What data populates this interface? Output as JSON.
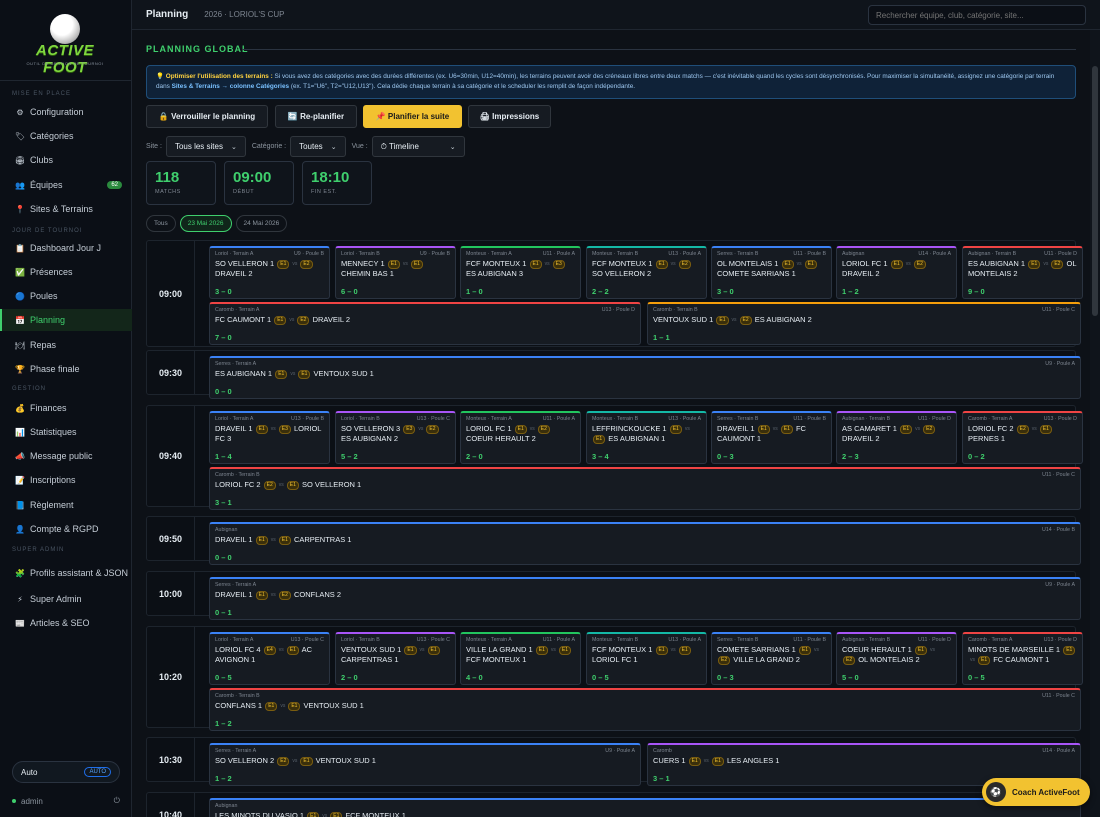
{
  "brand": {
    "name": "ACTIVE FOOT",
    "tagline": "OUTIL DE GESTION DE TOURNOI"
  },
  "sidebar": {
    "sections": [
      "MISE EN PLACE",
      "JOUR DE TOURNOI",
      "GESTION",
      "SUPER ADMIN"
    ],
    "items": [
      {
        "icon": "gear-icon",
        "glyph": "⚙",
        "label": "Configuration"
      },
      {
        "icon": "tag-icon",
        "glyph": "🏷",
        "label": "Catégories"
      },
      {
        "icon": "club-icon",
        "glyph": "🏟",
        "label": "Clubs"
      },
      {
        "icon": "team-icon",
        "glyph": "👥",
        "label": "Équipes",
        "badge": "62"
      },
      {
        "icon": "pin-icon",
        "glyph": "📍",
        "label": "Sites & Terrains"
      },
      {
        "icon": "dashboard-icon",
        "glyph": "📋",
        "label": "Dashboard Jour J"
      },
      {
        "icon": "check-icon",
        "glyph": "✅",
        "label": "Présences"
      },
      {
        "icon": "pool-icon",
        "glyph": "🔵",
        "label": "Poules"
      },
      {
        "icon": "calendar-icon",
        "glyph": "📅",
        "label": "Planning"
      },
      {
        "icon": "meal-icon",
        "glyph": "🍽",
        "label": "Repas"
      },
      {
        "icon": "trophy-icon",
        "glyph": "🏆",
        "label": "Phase finale"
      },
      {
        "icon": "money-icon",
        "glyph": "💰",
        "label": "Finances"
      },
      {
        "icon": "chart-icon",
        "glyph": "📊",
        "label": "Statistiques"
      },
      {
        "icon": "megaphone-icon",
        "glyph": "📣",
        "label": "Message public"
      },
      {
        "icon": "form-icon",
        "glyph": "📝",
        "label": "Inscriptions"
      },
      {
        "icon": "rules-icon",
        "glyph": "📘",
        "label": "Règlement"
      },
      {
        "icon": "account-icon",
        "glyph": "👤",
        "label": "Compte & RGPD"
      },
      {
        "icon": "profiles-icon",
        "glyph": "🧩",
        "label": "Profils assistant & JSON"
      },
      {
        "icon": "bolt-icon",
        "glyph": "⚡",
        "label": "Super Admin"
      },
      {
        "icon": "article-icon",
        "glyph": "📰",
        "label": "Articles & SEO"
      }
    ],
    "auto_label": "Auto",
    "auto_pill": "AUTO",
    "user": "admin"
  },
  "topbar": {
    "title": "Planning",
    "subtitle": "2026 · LORIOL'S CUP",
    "search_placeholder": "Rechercher équipe, club, catégorie, site..."
  },
  "page": {
    "heading": "PLANNING GLOBAL",
    "info_pre": "💡 ",
    "info_b1": "Optimiser l'utilisation des terrains :",
    "info_t1": " Si vous avez des catégories avec des durées différentes (ex. U6=30min, U12=40min), les terrains peuvent avoir des créneaux libres entre deux matchs — c'est inévitable quand les cycles sont désynchronisés. Pour maximiser la simultanéité, assignez une catégorie par terrain dans ",
    "info_l1": "Sites & Terrains → colonne Catégories",
    "info_t2": " (ex. T1=\"U6\", T2=\"U12,U13\"). Cela dédie chaque terrain à sa catégorie et le scheduler les remplit de façon indépendante.",
    "buttons": [
      "🔒 Verrouiller le planning",
      "🔄 Re-planifier",
      "📌 Planifier la suite",
      "🖨 Impressions"
    ],
    "filter_site_label": "Site :",
    "filter_site": "Tous les sites",
    "filter_cat_label": "Catégorie :",
    "filter_cat": "Toutes",
    "filter_view_label": "Vue :",
    "filter_view": "⏱ Timeline",
    "stats": [
      {
        "value": "118",
        "label": "MATCHS"
      },
      {
        "value": "09:00",
        "label": "DÉBUT"
      },
      {
        "value": "18:10",
        "label": "FIN EST."
      }
    ],
    "days": [
      "Tous",
      "23 Mai 2026",
      "24 Mai 2026"
    ]
  },
  "slots": [
    {
      "time": "09:00",
      "matches": [
        {
          "site": "Loriol · Terrain A",
          "cat": "U9 · Poule B",
          "home": "SO VELLERON 1",
          "hp": "E1",
          "away": "DRAVEIL 2",
          "ap": "E2",
          "score": "3 – 0"
        },
        {
          "site": "Loriol · Terrain B",
          "cat": "U9 · Poule B",
          "home": "MENNECY 1",
          "hp": "E1",
          "away": "CHEMIN BAS 1",
          "ap": "E1",
          "score": "6 – 0"
        },
        {
          "site": "Monteux · Terrain A",
          "cat": "U11 · Poule A",
          "home": "FCF MONTEUX 1",
          "hp": "E1",
          "away": "ES AUBIGNAN 3",
          "ap": "E3",
          "score": "1 – 0"
        },
        {
          "site": "Monteux · Terrain B",
          "cat": "U13 · Poule A",
          "home": "FCF MONTEUX 1",
          "hp": "E1",
          "away": "SO VELLERON 2",
          "ap": "E2",
          "score": "2 – 2"
        },
        {
          "site": "Serres · Terrain B",
          "cat": "U11 · Poule B",
          "home": "OL MONTELAIS 1",
          "hp": "E1",
          "away": "COMETE SARRIANS 1",
          "ap": "E1",
          "score": "3 – 0"
        },
        {
          "site": "Aubignan",
          "cat": "U14 · Poule A",
          "home": "LORIOL FC 1",
          "hp": "E1",
          "away": "DRAVEIL 2",
          "ap": "E2",
          "score": "1 – 2"
        },
        {
          "site": "Aubignan · Terrain B",
          "cat": "U11 · Poule D",
          "home": "ES AUBIGNAN 1",
          "hp": "E1",
          "away": "OL MONTELAIS 2",
          "ap": "E2",
          "score": "9 – 0"
        },
        {
          "site": "Caromb · Terrain A",
          "cat": "U13 · Poule D",
          "home": "FC CAUMONT 1",
          "hp": "E1",
          "away": "DRAVEIL 2",
          "ap": "E2",
          "score": "7 – 0"
        },
        {
          "site": "Caromb · Terrain B",
          "cat": "U11 · Poule C",
          "home": "VENTOUX SUD 1",
          "hp": "E1",
          "away": "ES AUBIGNAN 2",
          "ap": "E2",
          "score": "1 – 1"
        }
      ]
    },
    {
      "time": "09:30",
      "matches": [
        {
          "site": "Serres · Terrain A",
          "cat": "U9 · Poule A",
          "home": "ES AUBIGNAN 1",
          "hp": "E1",
          "away": "VENTOUX SUD 1",
          "ap": "E1",
          "score": "0 – 0"
        }
      ]
    },
    {
      "time": "09:40",
      "matches": [
        {
          "site": "Loriol · Terrain A",
          "cat": "U13 · Poule B",
          "home": "DRAVEIL 1",
          "hp": "E1",
          "away": "LORIOL FC 3",
          "ap": "E3",
          "score": "1 – 4"
        },
        {
          "site": "Loriol · Terrain B",
          "cat": "U13 · Poule C",
          "home": "SO VELLERON 3",
          "hp": "E3",
          "away": "ES AUBIGNAN 2",
          "ap": "E2",
          "score": "5 – 2"
        },
        {
          "site": "Monteux · Terrain A",
          "cat": "U11 · Poule A",
          "home": "LORIOL FC 1",
          "hp": "E1",
          "away": "COEUR HERAULT 2",
          "ap": "E2",
          "score": "2 – 0"
        },
        {
          "site": "Monteux · Terrain B",
          "cat": "U13 · Poule A",
          "home": "LEFFRINCKOUCKE 1",
          "hp": "E1",
          "away": "ES AUBIGNAN 1",
          "ap": "E1",
          "score": "3 – 4"
        },
        {
          "site": "Serres · Terrain B",
          "cat": "U11 · Poule B",
          "home": "DRAVEIL 1",
          "hp": "E1",
          "away": "FC CAUMONT 1",
          "ap": "E1",
          "score": "0 – 3"
        },
        {
          "site": "Aubignan · Terrain B",
          "cat": "U11 · Poule D",
          "home": "AS CAMARET 1",
          "hp": "E1",
          "away": "DRAVEIL 2",
          "ap": "E2",
          "score": "2 – 3"
        },
        {
          "site": "Caromb · Terrain A",
          "cat": "U13 · Poule D",
          "home": "LORIOL FC 2",
          "hp": "E2",
          "away": "PERNES 1",
          "ap": "E1",
          "score": "0 – 2"
        },
        {
          "site": "Caromb · Terrain B",
          "cat": "U11 · Poule C",
          "home": "LORIOL FC 2",
          "hp": "E2",
          "away": "SO VELLERON 1",
          "ap": "E1",
          "score": "3 – 1"
        }
      ]
    },
    {
      "time": "09:50",
      "matches": [
        {
          "site": "Aubignan",
          "cat": "U14 · Poule B",
          "home": "DRAVEIL 1",
          "hp": "E1",
          "away": "CARPENTRAS 1",
          "ap": "E1",
          "score": "0 – 0"
        }
      ]
    },
    {
      "time": "10:00",
      "matches": [
        {
          "site": "Serres · Terrain A",
          "cat": "U9 · Poule A",
          "home": "DRAVEIL 1",
          "hp": "E1",
          "away": "CONFLANS 2",
          "ap": "E2",
          "score": "0 – 1"
        }
      ]
    },
    {
      "time": "10:20",
      "matches": [
        {
          "site": "Loriol · Terrain A",
          "cat": "U13 · Poule C",
          "home": "LORIOL FC 4",
          "hp": "E4",
          "away": "AC AVIGNON 1",
          "ap": "E1",
          "score": "0 – 5"
        },
        {
          "site": "Loriol · Terrain B",
          "cat": "U13 · Poule C",
          "home": "VENTOUX SUD 1",
          "hp": "E1",
          "away": "CARPENTRAS 1",
          "ap": "E1",
          "score": "2 – 0"
        },
        {
          "site": "Monteux · Terrain A",
          "cat": "U11 · Poule A",
          "home": "VILLE LA GRAND 1",
          "hp": "E1",
          "away": "FCF MONTEUX 1",
          "ap": "E1",
          "score": "4 – 0"
        },
        {
          "site": "Monteux · Terrain B",
          "cat": "U13 · Poule A",
          "home": "FCF MONTEUX 1",
          "hp": "E1",
          "away": "LORIOL FC 1",
          "ap": "E1",
          "score": "0 – 5"
        },
        {
          "site": "Serres · Terrain B",
          "cat": "U11 · Poule B",
          "home": "COMETE SARRIANS 1",
          "hp": "E1",
          "away": "VILLE LA GRAND 2",
          "ap": "E2",
          "score": "0 – 3"
        },
        {
          "site": "Aubignan · Terrain B",
          "cat": "U11 · Poule D",
          "home": "COEUR HERAULT 1",
          "hp": "E1",
          "away": "OL MONTELAIS 2",
          "ap": "E2",
          "score": "5 – 0"
        },
        {
          "site": "Caromb · Terrain A",
          "cat": "U13 · Poule D",
          "home": "MINOTS DE MARSEILLE 1",
          "hp": "E1",
          "away": "FC CAUMONT 1",
          "ap": "E1",
          "score": "0 – 5"
        },
        {
          "site": "Caromb · Terrain B",
          "cat": "U11 · Poule C",
          "home": "CONFLANS 1",
          "hp": "E1",
          "away": "VENTOUX SUD 1",
          "ap": "E1",
          "score": "1 – 2"
        }
      ]
    },
    {
      "time": "10:30",
      "matches": [
        {
          "site": "Serres · Terrain A",
          "cat": "U9 · Poule A",
          "home": "SO VELLERON 2",
          "hp": "E2",
          "away": "VENTOUX SUD 1",
          "ap": "E1",
          "score": "1 – 2"
        },
        {
          "site": "Caromb",
          "cat": "U14 · Poule A",
          "home": "CUERS 1",
          "hp": "E1",
          "away": "LES ANGLES 1",
          "ap": "E1",
          "score": "3 – 1"
        }
      ]
    },
    {
      "time": "10:40",
      "matches": [
        {
          "site": "Aubignan",
          "cat": "",
          "home": "LES MINOTS DU VASIO 1",
          "hp": "E1",
          "away": "FCF MONTEUX 1",
          "ap": "E1",
          "score": ""
        }
      ]
    }
  ],
  "coach": {
    "label": "Coach ActiveFoot"
  },
  "colors": {
    "accent": "#3fcf6d",
    "primary_button": "#f2c230",
    "info_bg": "#0f2238"
  }
}
